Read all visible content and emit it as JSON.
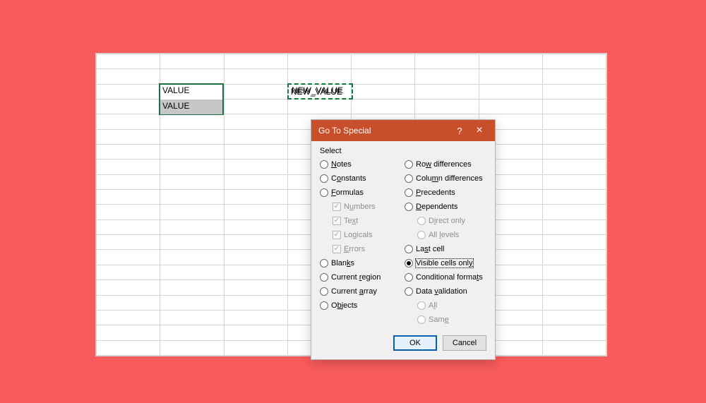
{
  "background_color": "#f85b5b",
  "spreadsheet": {
    "cellA1": "VALUE",
    "cellA2": "VALUE",
    "cellC1": "NEW_VALUE"
  },
  "dialog": {
    "title": "Go To Special",
    "help_symbol": "?",
    "close_symbol": "×",
    "section": "Select",
    "left_options": {
      "notes": "Notes",
      "constants": "Constants",
      "formulas": "Formulas",
      "numbers": "Numbers",
      "text": "Text",
      "logicals": "Logicals",
      "errors": "Errors",
      "blanks": "Blanks",
      "current_region": "Current region",
      "current_array": "Current array",
      "objects": "Objects"
    },
    "right_options": {
      "row_diff": "Row differences",
      "col_diff": "Column differences",
      "precedents": "Precedents",
      "dependents": "Dependents",
      "direct_only": "Direct only",
      "all_levels": "All levels",
      "last_cell": "Last cell",
      "visible_cells": "Visible cells only",
      "cond_formats": "Conditional formats",
      "data_validation": "Data validation",
      "all": "All",
      "same": "Same"
    },
    "selected": "visible_cells",
    "buttons": {
      "ok": "OK",
      "cancel": "Cancel"
    }
  }
}
